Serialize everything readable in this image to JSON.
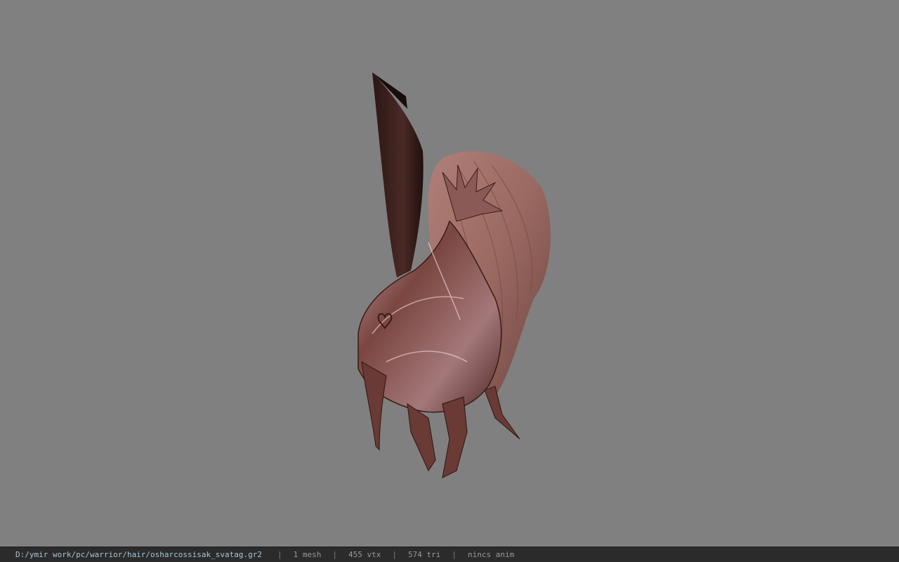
{
  "viewer": {
    "background_color": "#808080",
    "model_icon": "helmet-model"
  },
  "status_bar": {
    "file_path": "D:/ymir work/pc/warrior/hair/osharcossisak_svatag.gr2",
    "mesh_count": "1 mesh",
    "vertex_count": "455 vtx",
    "triangle_count": "574 tri",
    "animation": "nincs anim",
    "separator": "|"
  }
}
